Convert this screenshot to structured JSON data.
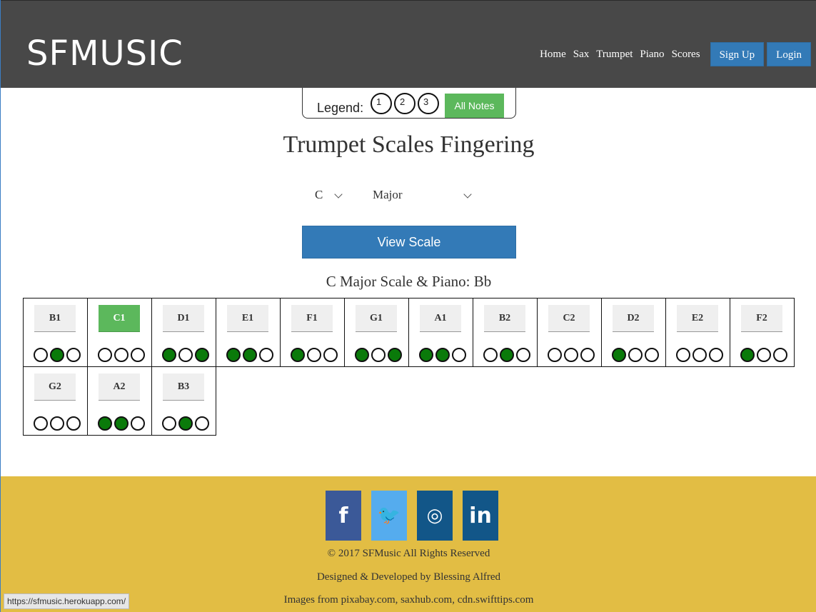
{
  "header": {
    "brand": "SFMUSIC",
    "nav": [
      "Home",
      "Sax",
      "Trumpet",
      "Piano",
      "Scores"
    ],
    "signup": "Sign Up",
    "login": "Login"
  },
  "legend": {
    "label": "Legend:",
    "circles": [
      "1",
      "2",
      "3"
    ],
    "all_notes": "All Notes"
  },
  "page": {
    "title": "Trumpet Scales Fingering",
    "key_select": "C",
    "mode_select": "Major",
    "view_button": "View Scale",
    "subtitle": "C Major Scale & Piano: Bb"
  },
  "notes": [
    {
      "name": "B1",
      "valves": [
        0,
        1,
        0
      ],
      "active": false
    },
    {
      "name": "C1",
      "valves": [
        0,
        0,
        0
      ],
      "active": true
    },
    {
      "name": "D1",
      "valves": [
        1,
        0,
        1
      ],
      "active": false
    },
    {
      "name": "E1",
      "valves": [
        1,
        1,
        0
      ],
      "active": false
    },
    {
      "name": "F1",
      "valves": [
        1,
        0,
        0
      ],
      "active": false
    },
    {
      "name": "G1",
      "valves": [
        1,
        0,
        1
      ],
      "active": false
    },
    {
      "name": "A1",
      "valves": [
        1,
        1,
        0
      ],
      "active": false
    },
    {
      "name": "B2",
      "valves": [
        0,
        1,
        0
      ],
      "active": false
    },
    {
      "name": "C2",
      "valves": [
        0,
        0,
        0
      ],
      "active": false
    },
    {
      "name": "D2",
      "valves": [
        1,
        0,
        0
      ],
      "active": false
    },
    {
      "name": "E2",
      "valves": [
        0,
        0,
        0
      ],
      "active": false
    },
    {
      "name": "F2",
      "valves": [
        1,
        0,
        0
      ],
      "active": false
    },
    {
      "name": "G2",
      "valves": [
        0,
        0,
        0
      ],
      "active": false
    },
    {
      "name": "A2",
      "valves": [
        1,
        1,
        0
      ],
      "active": false
    },
    {
      "name": "B3",
      "valves": [
        0,
        1,
        0
      ],
      "active": false
    }
  ],
  "footer": {
    "social": [
      {
        "icon": "facebook-icon",
        "glyph": "f",
        "color": "#3b5998"
      },
      {
        "icon": "twitter-icon",
        "glyph": "🐦",
        "color": "#55acee"
      },
      {
        "icon": "instagram-icon",
        "glyph": "◎",
        "color": "#125688"
      },
      {
        "icon": "linkedin-icon",
        "glyph": "in",
        "color": "#125688"
      }
    ],
    "copyright": "2017 SFMusic All Rights Reserved",
    "credits": "Designed & Developed by Blessing Alfred",
    "images": "Images from pixabay.com, saxhub.com, cdn.swifttips.com"
  },
  "status_url": "https://sfmusic.herokuapp.com/",
  "colors": {
    "header": "#484848",
    "primary": "#337ab7",
    "success": "#5cb85c",
    "valve_on": "#0a7a0a",
    "footer": "#e2bd44"
  }
}
